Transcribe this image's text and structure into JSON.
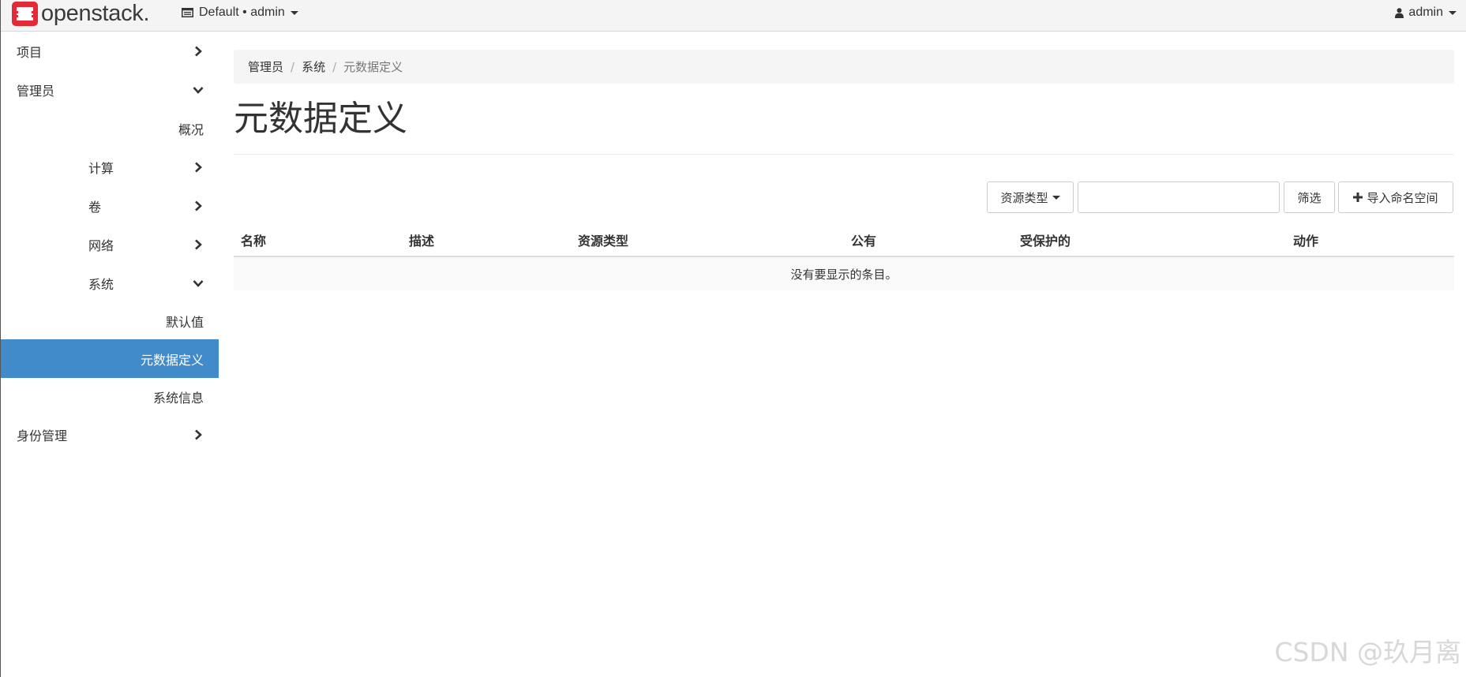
{
  "brand": {
    "name": "openstack.",
    "logo_color": "#e22b36"
  },
  "navbar": {
    "project_picker": {
      "icon": "context-icon",
      "label": "Default • admin"
    },
    "user_menu": {
      "icon": "user-icon",
      "label": "admin"
    }
  },
  "sidebar": {
    "items": [
      {
        "label": "项目",
        "icon": "chevron-right-icon"
      },
      {
        "label": "管理员",
        "icon": "chevron-down-icon"
      },
      {
        "label": "概况"
      },
      {
        "label": "计算",
        "icon": "chevron-right-icon"
      },
      {
        "label": "卷",
        "icon": "chevron-right-icon"
      },
      {
        "label": "网络",
        "icon": "chevron-right-icon"
      },
      {
        "label": "系统",
        "icon": "chevron-down-icon"
      },
      {
        "label": "默认值"
      },
      {
        "label": "元数据定义",
        "active": true
      },
      {
        "label": "系统信息"
      },
      {
        "label": "身份管理",
        "icon": "chevron-right-icon"
      }
    ],
    "active_color": "#428bca"
  },
  "breadcrumb": {
    "items": [
      "管理员",
      "系统",
      "元数据定义"
    ],
    "separator": "/"
  },
  "page": {
    "title": "元数据定义"
  },
  "toolbar": {
    "resource_type_label": "资源类型",
    "filter_value": "",
    "filter_label": "筛选",
    "import_label": "导入命名空间",
    "import_icon": "plus-icon"
  },
  "table": {
    "columns": [
      "名称",
      "描述",
      "资源类型",
      "公有",
      "受保护的",
      "动作"
    ],
    "empty_message": "没有要显示的条目。"
  },
  "watermark": "CSDN @玖月离"
}
